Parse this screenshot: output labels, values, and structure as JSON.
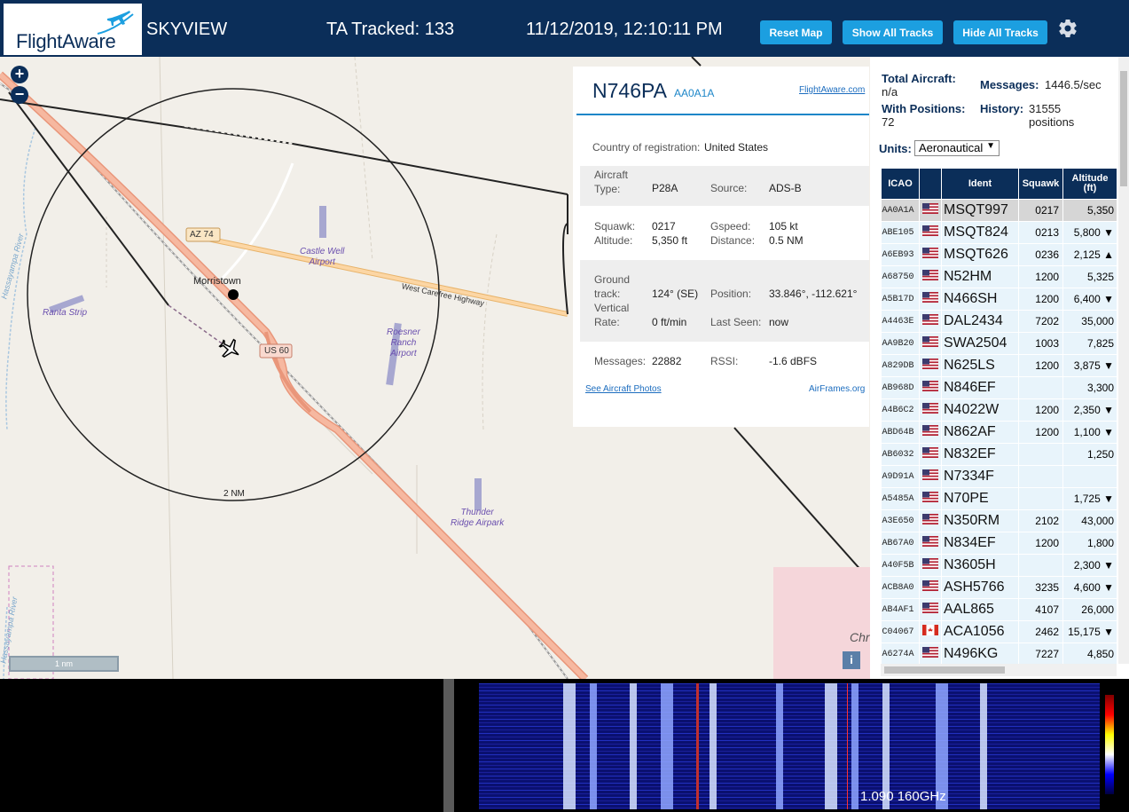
{
  "header": {
    "logo": "FlightAware",
    "app_name": "SKYVIEW",
    "tracked": "TA Tracked: 133",
    "datetime": "11/12/2019, 12:10:11 PM",
    "buttons": {
      "reset_map": "Reset Map",
      "show_all": "Show All Tracks",
      "hide_all": "Hide All Tracks"
    }
  },
  "map": {
    "zoom_in": "+",
    "zoom_out": "−",
    "labels": {
      "az74": "AZ 74",
      "us60": "US 60",
      "morristown": "Morristown",
      "castle_well": "Castle Well\nAirport",
      "ranta": "Ranta Strip",
      "roesner": "Roesner\nRanch\nAirport",
      "thunder": "Thunder\nRidge Airpark",
      "highway": "West Carefree Highway",
      "river": "Hassayampa River",
      "river2": "Hassayampa River",
      "ring": "2 NM",
      "chr": "Chr",
      "info": "i"
    },
    "scale": "1 nm"
  },
  "aircraft": {
    "reg": "N746PA",
    "icao": "AA0A1A",
    "fa_link": "FlightAware.com",
    "country_label": "Country of registration:",
    "country": "United States",
    "type_label": "Aircraft\nType:",
    "type": "P28A",
    "source_label": "Source:",
    "source": "ADS-B",
    "squawk_label": "Squawk:",
    "squawk": "0217",
    "altitude_label": "Altitude:",
    "altitude": "5,350 ft",
    "gspeed_label": "Gspeed:",
    "gspeed": "105 kt",
    "distance_label": "Distance:",
    "distance": "0.5 NM",
    "track_label": "Ground\ntrack:",
    "track": "124° (SE)",
    "vrate_label": "Vertical\nRate:",
    "vrate": "0 ft/min",
    "position_label": "Position:",
    "position": "33.846°, -112.621°",
    "lastseen_label": "Last Seen:",
    "lastseen": "now",
    "messages_label": "Messages:",
    "messages": "22882",
    "rssi_label": "RSSI:",
    "rssi": "-1.6 dBFS",
    "photos_link": "See Aircraft Photos",
    "airframes_link": "AirFrames.org"
  },
  "stats": {
    "total_label": "Total Aircraft:",
    "total": "n/a",
    "messages_label": "Messages:",
    "messages": "1446.5/sec",
    "positions_label": "With Positions:",
    "positions": "72",
    "history_label": "History:",
    "history": "31555\npositions",
    "units_label": "Units:",
    "units": "Aeronautical"
  },
  "table": {
    "headers": [
      "ICAO",
      "",
      "Ident",
      "Squawk",
      "Altitude\n(ft)"
    ],
    "rows": [
      {
        "icao": "AA0A1A",
        "flag": "us",
        "ident": "MSQT997",
        "squawk": "0217",
        "alt": "5,350",
        "sel": true
      },
      {
        "icao": "ABE105",
        "flag": "us",
        "ident": "MSQT824",
        "squawk": "0213",
        "alt": "5,800 ▼"
      },
      {
        "icao": "A6EB93",
        "flag": "us",
        "ident": "MSQT626",
        "squawk": "0236",
        "alt": "2,125 ▲"
      },
      {
        "icao": "A68750",
        "flag": "us",
        "ident": "N52HM",
        "squawk": "1200",
        "alt": "5,325"
      },
      {
        "icao": "A5B17D",
        "flag": "us",
        "ident": "N466SH",
        "squawk": "1200",
        "alt": "6,400 ▼"
      },
      {
        "icao": "A4463E",
        "flag": "us",
        "ident": "DAL2434",
        "squawk": "7202",
        "alt": "35,000"
      },
      {
        "icao": "AA9B20",
        "flag": "us",
        "ident": "SWA2504",
        "squawk": "1003",
        "alt": "7,825"
      },
      {
        "icao": "A829DB",
        "flag": "us",
        "ident": "N625LS",
        "squawk": "1200",
        "alt": "3,875 ▼"
      },
      {
        "icao": "AB968D",
        "flag": "us",
        "ident": "N846EF",
        "squawk": "",
        "alt": "3,300"
      },
      {
        "icao": "A4B6C2",
        "flag": "us",
        "ident": "N4022W",
        "squawk": "1200",
        "alt": "2,350 ▼"
      },
      {
        "icao": "ABD64B",
        "flag": "us",
        "ident": "N862AF",
        "squawk": "1200",
        "alt": "1,100 ▼"
      },
      {
        "icao": "AB6032",
        "flag": "us",
        "ident": "N832EF",
        "squawk": "",
        "alt": "1,250"
      },
      {
        "icao": "A9D91A",
        "flag": "us",
        "ident": "N7334F",
        "squawk": "",
        "alt": ""
      },
      {
        "icao": "A5485A",
        "flag": "us",
        "ident": "N70PE",
        "squawk": "",
        "alt": "1,725 ▼"
      },
      {
        "icao": "A3E650",
        "flag": "us",
        "ident": "N350RM",
        "squawk": "2102",
        "alt": "43,000"
      },
      {
        "icao": "AB67A0",
        "flag": "us",
        "ident": "N834EF",
        "squawk": "1200",
        "alt": "1,800"
      },
      {
        "icao": "A40F5B",
        "flag": "us",
        "ident": "N3605H",
        "squawk": "",
        "alt": "2,300 ▼"
      },
      {
        "icao": "ACB8A0",
        "flag": "us",
        "ident": "ASH5766",
        "squawk": "3235",
        "alt": "4,600 ▼"
      },
      {
        "icao": "AB4AF1",
        "flag": "us",
        "ident": "AAL865",
        "squawk": "4107",
        "alt": "26,000"
      },
      {
        "icao": "C04067",
        "flag": "ca",
        "ident": "ACA1056",
        "squawk": "2462",
        "alt": "15,175 ▼"
      },
      {
        "icao": "A6274A",
        "flag": "us",
        "ident": "N496KG",
        "squawk": "7227",
        "alt": "4,850"
      }
    ]
  },
  "spectrum": {
    "label": "1.090 160GHz"
  },
  "colors": {
    "header": "#0b2e59",
    "button": "#1c9fe0",
    "row_bg": "#e8f4fb",
    "road": "#f4a582"
  }
}
